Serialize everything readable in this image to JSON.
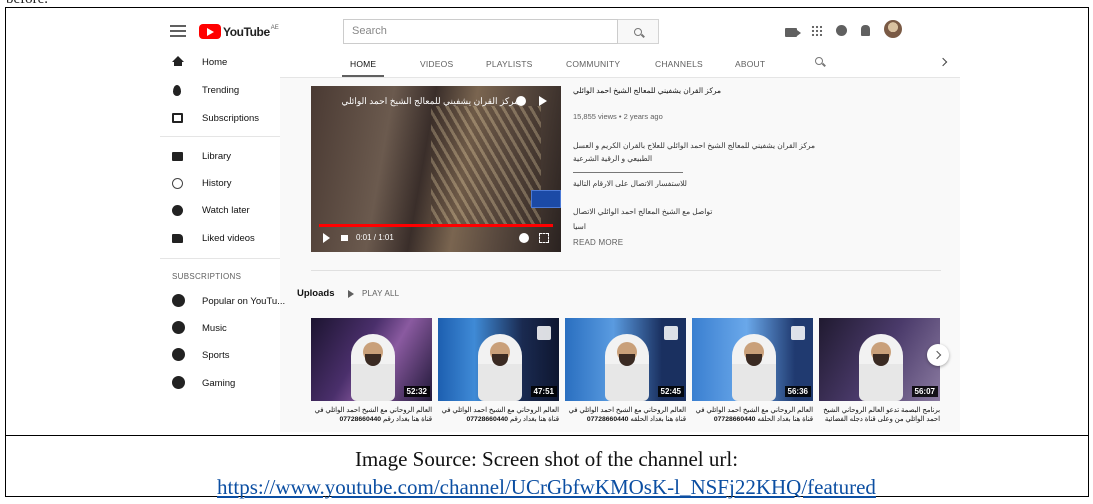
{
  "doc": {
    "top_fragment": "before.",
    "caption_line1": "Image Source: Screen shot of the channel url:",
    "caption_link": "https://www.youtube.com/channel/UCrGbfwKMOsK-l_NSFj22KHQ/featured"
  },
  "masthead": {
    "logo_text": "YouTube",
    "country": "AE",
    "search_placeholder": "Search"
  },
  "sidebar": {
    "items": [
      {
        "label": "Home",
        "icon": "home-icon"
      },
      {
        "label": "Trending",
        "icon": "trending-icon"
      },
      {
        "label": "Subscriptions",
        "icon": "subscriptions-icon"
      },
      {
        "label": "Library",
        "icon": "library-icon"
      },
      {
        "label": "History",
        "icon": "history-icon"
      },
      {
        "label": "Watch later",
        "icon": "watch-later-icon"
      },
      {
        "label": "Liked videos",
        "icon": "liked-videos-icon"
      }
    ],
    "subscriptions_header": "SUBSCRIPTIONS",
    "channels": [
      {
        "label": "Popular on YouTu...",
        "icon": "popular-icon"
      },
      {
        "label": "Music",
        "icon": "music-icon"
      },
      {
        "label": "Sports",
        "icon": "sports-icon"
      },
      {
        "label": "Gaming",
        "icon": "gaming-icon"
      }
    ]
  },
  "tabs": [
    "HOME",
    "VIDEOS",
    "PLAYLISTS",
    "COMMUNITY",
    "CHANNELS",
    "ABOUT"
  ],
  "active_tab": "HOME",
  "featured": {
    "title_overlay": "مركز القران يشفيني للمعالج الشيخ احمد الوائلي",
    "time": "0:01 / 1:01",
    "title": "مركز القران يشفيني للمعالج الشيخ احمد الوائلي",
    "meta": "15,855 views • 2 years ago",
    "desc_line1": "مركز القران يشفيني للمعالج الشيخ احمد الوائلي للعلاج بالقران الكريم و العسل الطبيعي و الرقية الشرعية",
    "desc_line2": "للاستفسار الاتصال على الارقام التالية",
    "desc_line3": "تواصل مع الشيخ المعالج احمد الوائلي الاتصال",
    "desc_line4": "اسيا",
    "read_more": "READ MORE"
  },
  "uploads": {
    "heading": "Uploads",
    "play_all": "PLAY ALL",
    "videos": [
      {
        "duration": "52:32",
        "title_a": "العالم الروحاني مع الشيخ احمد الوائلي في",
        "title_b": "قناة هنا بغداد رقم",
        "phone": "07728660440"
      },
      {
        "duration": "47:51",
        "title_a": "العالم الروحاني مع الشيخ احمد الوائلي في",
        "title_b": "قناة هنا بغداد رقم",
        "phone": "07728660440"
      },
      {
        "duration": "52:45",
        "title_a": "العالم الروحاني مع الشيخ احمد الوائلي في",
        "title_b": "قناة هنا بغداد الحلقه",
        "phone": "07728660440"
      },
      {
        "duration": "56:36",
        "title_a": "العالم الروحاني مع الشيخ احمد الوائلي في",
        "title_b": "قناة هنا بغداد الحلقه",
        "phone": "07728660440"
      },
      {
        "duration": "56:07",
        "title_a": "برنامج البصمة تدعو العالم الروحاني الشيخ",
        "title_b": "احمد الوائلي من وعلى قناة دجله الفضائية",
        "phone": ""
      }
    ]
  },
  "colors": {
    "brand_red": "#ff0000",
    "link_blue": "#0b4ea2"
  }
}
